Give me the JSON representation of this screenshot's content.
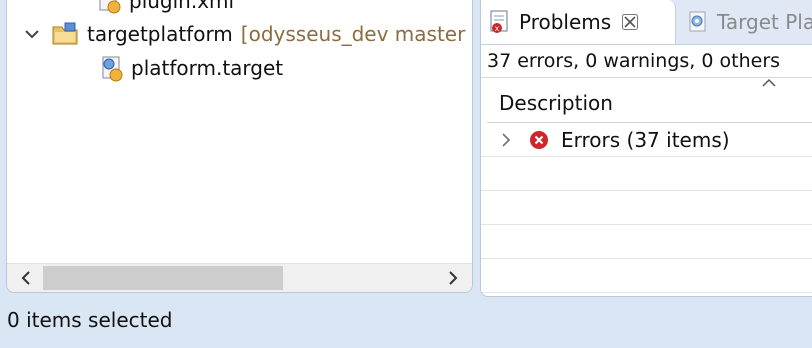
{
  "explorer": {
    "partial_item": {
      "label": "plugin.xml",
      "icon": "plugin-xml-file-icon"
    },
    "project": {
      "label": "targetplatform",
      "decoration": "[odysseus_dev master b",
      "icon": "folder-project-icon",
      "expanded": true
    },
    "child": {
      "label": "platform.target",
      "icon": "target-file-icon"
    }
  },
  "problems": {
    "active_tab": "Problems",
    "inactive_tab": "Target Pla",
    "summary": "37 errors, 0 warnings, 0 others",
    "column_header": "Description",
    "error_group": "Errors (37 items)"
  },
  "status_bar": {
    "text": "0 items selected"
  },
  "colors": {
    "window_bg": "#dbe6f4",
    "decoration_text": "#8c6d3f",
    "error_red": "#d0262b"
  }
}
